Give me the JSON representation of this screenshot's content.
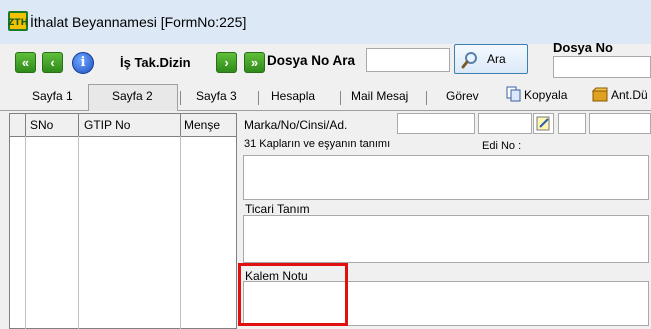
{
  "window": {
    "title": "İthalat Beyannamesi [FormNo:225]",
    "app_icon": "zth-logo"
  },
  "toolbar": {
    "first_icon": "double-chevron-left-icon",
    "prev_icon": "chevron-left-icon",
    "info_icon": "info-icon",
    "is_takip_label": "İş Tak.Dizin",
    "next_icon": "chevron-right-icon",
    "last_icon": "double-chevron-right-icon",
    "dosya_no_ara_label": "Dosya No Ara",
    "search_value": "",
    "ara_button_label": "Ara",
    "dosya_no_label": "Dosya No",
    "dosya_no_value": ""
  },
  "tabs": {
    "items": [
      {
        "label": "Sayfa 1"
      },
      {
        "label": "Sayfa 2"
      },
      {
        "label": "Sayfa 3"
      },
      {
        "label": "Hesapla"
      },
      {
        "label": "Mail Mesaj"
      },
      {
        "label": "Görev"
      },
      {
        "label": "Kopyala"
      },
      {
        "label": "Ant.Dü"
      }
    ],
    "active": "Sayfa 2"
  },
  "grid": {
    "columns": [
      "",
      "SNo",
      "GTIP No",
      "Menşe"
    ]
  },
  "form": {
    "marka_label": "Marka/No/Cinsi/Ad.",
    "kaplar_label": "31 Kapların ve eşyanın tanımı",
    "edi_label": "Edi No :",
    "ticari_label": "Ticari Tanım",
    "kalem_label": "Kalem Notu"
  },
  "colors": {
    "highlight": "#e01010",
    "accent": "#3c7fb1"
  }
}
